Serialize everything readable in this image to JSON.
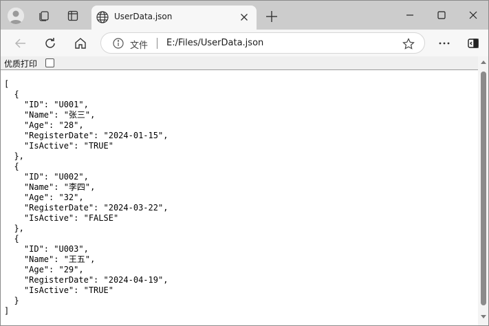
{
  "browser": {
    "tab": {
      "title": "UserData.json"
    },
    "address_bar": {
      "label": "文件",
      "url": "E:/Files/UserData.json"
    }
  },
  "pretty_print": {
    "label": "优质打印",
    "checked": false
  },
  "json_text": "[\n  {\n    \"ID\": \"U001\",\n    \"Name\": \"张三\",\n    \"Age\": \"28\",\n    \"RegisterDate\": \"2024-01-15\",\n    \"IsActive\": \"TRUE\"\n  },\n  {\n    \"ID\": \"U002\",\n    \"Name\": \"李四\",\n    \"Age\": \"32\",\n    \"RegisterDate\": \"2024-03-22\",\n    \"IsActive\": \"FALSE\"\n  },\n  {\n    \"ID\": \"U003\",\n    \"Name\": \"王五\",\n    \"Age\": \"29\",\n    \"RegisterDate\": \"2024-04-19\",\n    \"IsActive\": \"TRUE\"\n  }\n]",
  "icons": {
    "profile": "profile-avatar-icon",
    "workspaces": "workspaces-icon",
    "tab_actions": "tab-actions-icon",
    "favicon": "globe-icon",
    "close_tab": "close-icon",
    "new_tab": "plus-icon",
    "minimize": "minimize-icon",
    "maximize": "maximize-icon",
    "close_window": "close-icon",
    "back": "back-arrow-icon",
    "refresh": "refresh-icon",
    "home": "home-icon",
    "info": "info-icon",
    "favorite": "star-icon",
    "more": "more-icon",
    "sidebar": "sidebar-icon"
  },
  "colors": {
    "tabstrip": "#cccccc",
    "toolbar": "#f7f7f7",
    "scroll_thumb": "#8b8b8b"
  }
}
